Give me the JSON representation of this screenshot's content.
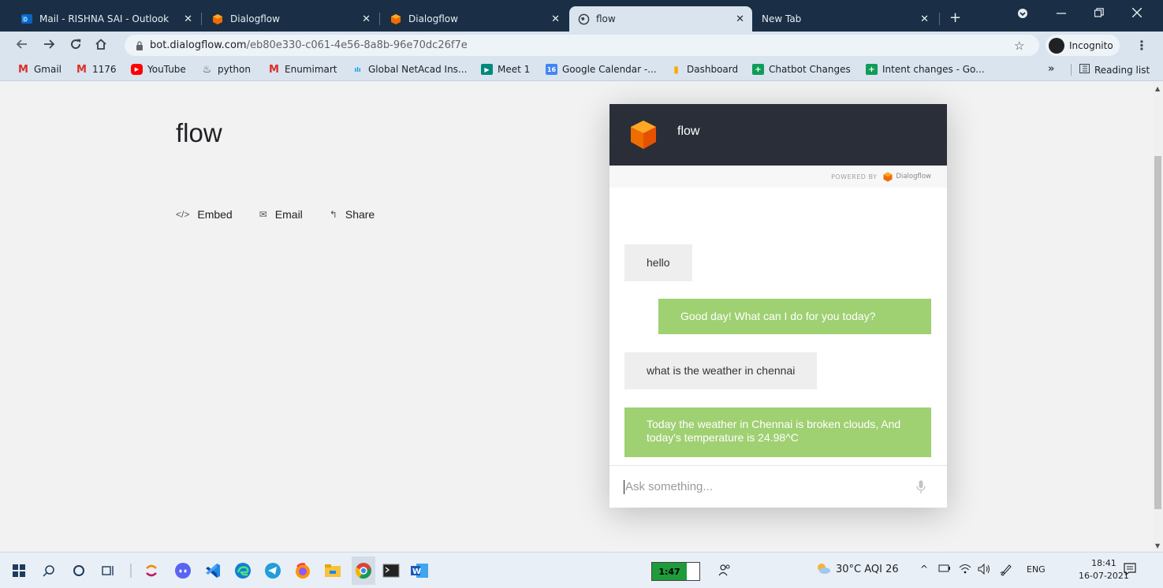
{
  "browser": {
    "tabs": [
      {
        "title": "Mail - RISHNA SAI - Outlook",
        "icon": "outlook-icon",
        "active": false
      },
      {
        "title": "Dialogflow",
        "icon": "dialogflow-icon",
        "active": false
      },
      {
        "title": "Dialogflow",
        "icon": "dialogflow-icon",
        "active": false
      },
      {
        "title": "flow",
        "icon": "globe-icon",
        "active": true
      },
      {
        "title": "New Tab",
        "icon": "",
        "active": false
      }
    ],
    "tab_close": "✕",
    "new_tab": "+",
    "url_host": "bot.dialogflow.com",
    "url_path": "/eb80e330-c061-4e56-8a8b-96e70dc26f7e",
    "incognito_label": "Incognito",
    "bookmarks": [
      {
        "label": "Gmail",
        "icon": "gmail-icon",
        "color": "#d93025"
      },
      {
        "label": "1176",
        "icon": "gmail-icon",
        "color": "#d93025"
      },
      {
        "label": "YouTube",
        "icon": "youtube-icon",
        "color": "#ff0000"
      },
      {
        "label": "python",
        "icon": "python-icon",
        "color": "#3776ab"
      },
      {
        "label": "Enumimart",
        "icon": "gmail-icon",
        "color": "#d93025"
      },
      {
        "label": "Global NetAcad Ins...",
        "icon": "cisco-icon",
        "color": "#049fd9"
      },
      {
        "label": "Meet 1",
        "icon": "meet-icon",
        "color": "#00897b"
      },
      {
        "label": "Google Calendar -...",
        "icon": "calendar-icon",
        "color": "#4285f4"
      },
      {
        "label": "Dashboard",
        "icon": "dashboard-icon",
        "color": "#f9ab00"
      },
      {
        "label": "Chatbot Changes",
        "icon": "sheets-icon",
        "color": "#0f9d58"
      },
      {
        "label": "Intent changes - Go...",
        "icon": "sheets-icon",
        "color": "#0f9d58"
      }
    ],
    "bookmarks_more": "»",
    "reading_list": "Reading list"
  },
  "page": {
    "agent_title": "flow",
    "actions": [
      {
        "label": "Embed",
        "icon": "embed-icon",
        "glyph": "</>"
      },
      {
        "label": "Email",
        "icon": "mail-icon",
        "glyph": "✉"
      },
      {
        "label": "Share",
        "icon": "share-icon",
        "glyph": "↰"
      }
    ]
  },
  "chat": {
    "agent_name": "flow",
    "powered_by": "POWERED BY",
    "powered_brand": "Dialogflow",
    "messages": [
      {
        "from": "user",
        "text": "hello"
      },
      {
        "from": "bot",
        "text": "Good day! What can I do for you today?"
      },
      {
        "from": "user",
        "text": "what is the weather in chennai"
      },
      {
        "from": "bot",
        "text": "Today the weather in Chennai is broken clouds, And today's temperature is 24.98^C"
      }
    ],
    "input_placeholder": "Ask something...",
    "bot_color": "#9fd072",
    "header_color": "#2a2e38"
  },
  "taskbar": {
    "timer": "1:47",
    "weather": "30°C  AQI 26",
    "language": "ENG",
    "time": "18:41",
    "date": "16-07-2021"
  }
}
